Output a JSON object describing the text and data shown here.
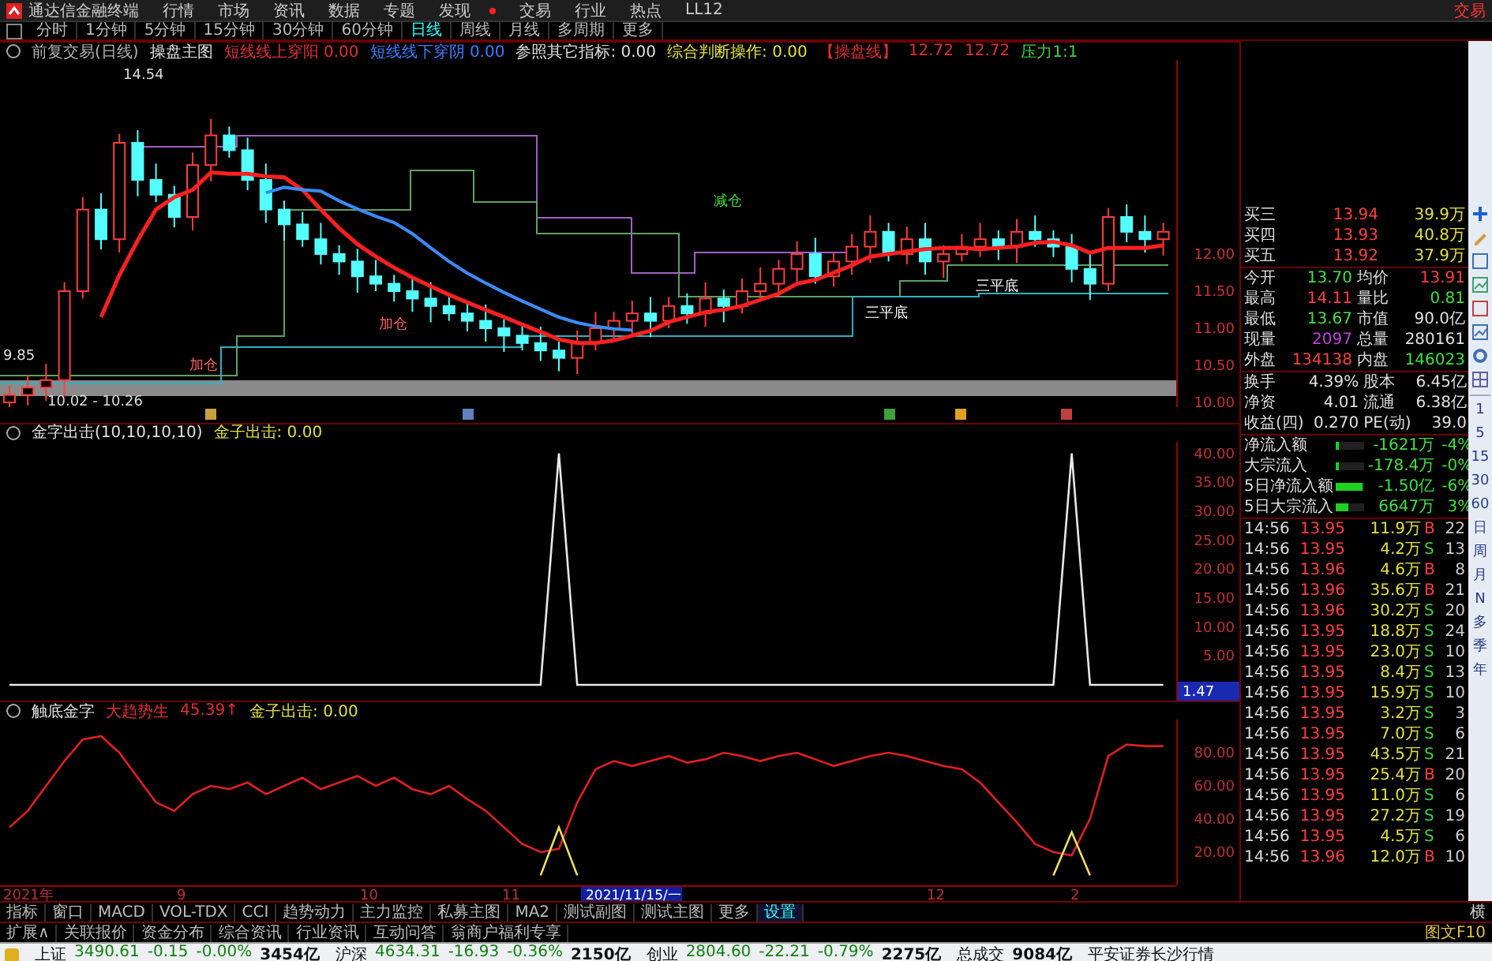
{
  "app": {
    "title": "通达信金融终端",
    "trade": "交易",
    "menu": [
      {
        "label": "行情",
        "dot": false
      },
      {
        "label": "市场",
        "dot": false
      },
      {
        "label": "资讯",
        "dot": false
      },
      {
        "label": "数据",
        "dot": false
      },
      {
        "label": "专题",
        "dot": false
      },
      {
        "label": "发现",
        "dot": true
      },
      {
        "label": "交易",
        "dot": false
      },
      {
        "label": "行业",
        "dot": false
      },
      {
        "label": "热点",
        "dot": false
      },
      {
        "label": "LL12",
        "dot": false
      }
    ]
  },
  "periods": [
    {
      "label": "分时",
      "selected": false
    },
    {
      "label": "1分钟",
      "selected": false
    },
    {
      "label": "5分钟",
      "selected": false
    },
    {
      "label": "15分钟",
      "selected": false
    },
    {
      "label": "30分钟",
      "selected": false
    },
    {
      "label": "60分钟",
      "selected": false
    },
    {
      "label": "日线",
      "selected": true
    },
    {
      "label": "周线",
      "selected": false
    },
    {
      "label": "月线",
      "selected": false
    },
    {
      "label": "多周期",
      "selected": false
    },
    {
      "label": "更多",
      "selected": false
    }
  ],
  "main_chart": {
    "header": [
      {
        "text": "前复交易(日线)",
        "color": "#b0b0b0"
      },
      {
        "text": "操盘主图",
        "color": "#e0e0e0"
      },
      {
        "text": "短线线上穿阳 0.00",
        "color": "#e03030"
      },
      {
        "text": "短线线下穿阴 0.00",
        "color": "#3a7cff"
      },
      {
        "text": "参照其它指标: 0.00",
        "color": "#e0e0e0"
      },
      {
        "text": "综合判断操作: 0.00",
        "color": "#e0e040"
      },
      {
        "text": "【操盘线】",
        "color": "#e03030"
      },
      {
        "text": "12.72",
        "color": "#e03030"
      },
      {
        "text": "12.72",
        "color": "#e03030"
      },
      {
        "text": "压力1:1",
        "color": "#40d040"
      }
    ],
    "annotations": [
      {
        "text": "14.54"
      },
      {
        "text": "9.85"
      },
      {
        "text": "10.02 - 10.26"
      },
      {
        "text": "加仓"
      },
      {
        "text": "加仓"
      },
      {
        "text": "减仓"
      },
      {
        "text": "三平底"
      },
      {
        "text": "三平底"
      }
    ],
    "price_axis": [
      "12.00",
      "11.50",
      "11.00",
      "10.50",
      "10.00"
    ]
  },
  "indicator_1": {
    "header": [
      {
        "text": "金字出击(10,10,10,10)",
        "color": "#e0e0e0"
      },
      {
        "text": "金子出击: 0.00",
        "color": "#e0e040"
      }
    ],
    "cursor_value": "1.47",
    "chart_data": {
      "type": "line",
      "ylim": [
        -3,
        42
      ],
      "yticks": [
        {
          "value": 40,
          "label": "40.00"
        },
        {
          "value": 35,
          "label": "35.00"
        },
        {
          "value": 30,
          "label": "30.00"
        },
        {
          "value": 25,
          "label": "25.00"
        },
        {
          "value": 20,
          "label": "20.00"
        },
        {
          "value": 15,
          "label": "15.00"
        },
        {
          "value": 10,
          "label": "10.00"
        },
        {
          "value": 5,
          "label": "5.00"
        }
      ],
      "series": [
        {
          "color": "#e8e8e8",
          "values": [
            0,
            0,
            0,
            0,
            0,
            0,
            0,
            0,
            0,
            0,
            0,
            0,
            0,
            0,
            0,
            0,
            0,
            0,
            0,
            0,
            0,
            0,
            0,
            0,
            0,
            0,
            0,
            0,
            0,
            0,
            40,
            0,
            0,
            0,
            0,
            0,
            0,
            0,
            0,
            0,
            0,
            0,
            0,
            0,
            0,
            0,
            0,
            0,
            0,
            0,
            0,
            0,
            0,
            0,
            0,
            0,
            0,
            0,
            40,
            0,
            0,
            0,
            0,
            0
          ]
        }
      ]
    }
  },
  "indicator_2": {
    "header": [
      {
        "text": "触底金字",
        "color": "#e0e0e0"
      },
      {
        "text": "大趋势生",
        "color": "#e03030"
      },
      {
        "text": "45.39↑",
        "color": "#e03030"
      },
      {
        "text": "金子出击: 0.00",
        "color": "#e0e040"
      }
    ],
    "chart_data": {
      "type": "line",
      "ylim": [
        0,
        100
      ],
      "yticks": [
        {
          "value": 80,
          "label": "80.00"
        },
        {
          "value": 60,
          "label": "60.00"
        },
        {
          "value": 40,
          "label": "40.00"
        },
        {
          "value": 20,
          "label": "20.00"
        }
      ],
      "series": [
        {
          "color": "#e02020",
          "values": [
            35,
            45,
            60,
            75,
            88,
            90,
            80,
            65,
            50,
            45,
            55,
            60,
            58,
            62,
            55,
            60,
            65,
            58,
            62,
            66,
            60,
            65,
            58,
            55,
            60,
            52,
            45,
            35,
            25,
            20,
            22,
            50,
            70,
            75,
            72,
            75,
            78,
            74,
            76,
            80,
            78,
            75,
            78,
            80,
            76,
            72,
            75,
            78,
            80,
            78,
            75,
            72,
            70,
            62,
            50,
            38,
            25,
            20,
            18,
            40,
            78,
            85,
            84,
            84
          ]
        },
        {
          "color": "#f0e060",
          "values": [
            null,
            null,
            null,
            null,
            null,
            null,
            null,
            null,
            null,
            null,
            null,
            null,
            null,
            null,
            null,
            null,
            null,
            null,
            null,
            null,
            null,
            null,
            null,
            null,
            null,
            null,
            null,
            null,
            null,
            6,
            35,
            6,
            null,
            null,
            null,
            null,
            null,
            null,
            null,
            null,
            null,
            null,
            null,
            null,
            null,
            null,
            null,
            null,
            null,
            null,
            null,
            null,
            null,
            null,
            null,
            null,
            null,
            6,
            32,
            6,
            null,
            null,
            null,
            null
          ]
        }
      ]
    }
  },
  "date_axis": {
    "labels": [
      "2021年",
      "9",
      "10",
      "11",
      "12",
      "2"
    ],
    "cursor_date": "2021/11/15/一"
  },
  "quote_panel": {
    "bids": [
      {
        "label": "买三",
        "price": "13.94",
        "volume": "39.9万"
      },
      {
        "label": "买四",
        "price": "13.93",
        "volume": "40.8万"
      },
      {
        "label": "买五",
        "price": "13.92",
        "volume": "37.9万"
      }
    ],
    "stats": [
      {
        "label": "今开",
        "value": "13.70",
        "color": "#40e040"
      },
      {
        "label": "均价",
        "value": "13.91",
        "color": "#ff4040"
      },
      {
        "label": "最高",
        "value": "14.11",
        "color": "#ff4040"
      },
      {
        "label": "量比",
        "value": "0.81",
        "color": "#40e040"
      },
      {
        "label": "最低",
        "value": "13.67",
        "color": "#40e040"
      },
      {
        "label": "市值",
        "value": "90.0亿",
        "color": "#e0e0e0"
      },
      {
        "label": "现量",
        "value": "2097",
        "color": "#c040e0"
      },
      {
        "label": "总量",
        "value": "280161",
        "color": "#e0e0e0"
      },
      {
        "label": "外盘",
        "value": "134138",
        "color": "#ff4040"
      },
      {
        "label": "内盘",
        "value": "146023",
        "color": "#40e040"
      }
    ],
    "stats2": [
      {
        "label": "换手",
        "value": "4.39%",
        "label2": "股本",
        "value2": "6.45亿"
      },
      {
        "label": "净资",
        "value": "4.01",
        "label2": "流通",
        "value2": "6.38亿"
      },
      {
        "label": "收益(四)",
        "value": "0.270",
        "label2": "PE(动)",
        "value2": "39.0"
      }
    ],
    "fund_flow": [
      {
        "label": "净流入额",
        "level": 0.08,
        "value": "-1621万",
        "pct": "-4%"
      },
      {
        "label": "大宗流入",
        "level": 0.08,
        "value": "-178.4万",
        "pct": "-0%"
      },
      {
        "label": "5日净流入额",
        "level": 0.9,
        "value": "-1.50亿",
        "pct": "-6%"
      },
      {
        "label": "5日大宗流入",
        "level": 0.4,
        "value": "6647万",
        "pct": "3%"
      }
    ],
    "ticks": [
      {
        "time": "14:56",
        "price": "13.95",
        "volume": "11.9万",
        "flag": "B",
        "kind": "buy",
        "count": "22"
      },
      {
        "time": "14:56",
        "price": "13.95",
        "volume": "4.2万",
        "flag": "S",
        "kind": "sell",
        "count": "13"
      },
      {
        "time": "14:56",
        "price": "13.96",
        "volume": "4.6万",
        "flag": "B",
        "kind": "buy",
        "count": "8"
      },
      {
        "time": "14:56",
        "price": "13.96",
        "volume": "35.6万",
        "flag": "B",
        "kind": "buy",
        "count": "21"
      },
      {
        "time": "14:56",
        "price": "13.96",
        "volume": "30.2万",
        "flag": "S",
        "kind": "sell",
        "count": "20"
      },
      {
        "time": "14:56",
        "price": "13.95",
        "volume": "18.8万",
        "flag": "S",
        "kind": "sell",
        "count": "24"
      },
      {
        "time": "14:56",
        "price": "13.95",
        "volume": "23.0万",
        "flag": "S",
        "kind": "sell",
        "count": "10"
      },
      {
        "time": "14:56",
        "price": "13.95",
        "volume": "8.4万",
        "flag": "S",
        "kind": "sell",
        "count": "13"
      },
      {
        "time": "14:56",
        "price": "13.95",
        "volume": "15.9万",
        "flag": "S",
        "kind": "sell",
        "count": "10"
      },
      {
        "time": "14:56",
        "price": "13.95",
        "volume": "3.2万",
        "flag": "S",
        "kind": "sell",
        "count": "3"
      },
      {
        "time": "14:56",
        "price": "13.95",
        "volume": "7.0万",
        "flag": "S",
        "kind": "sell",
        "count": "6"
      },
      {
        "time": "14:56",
        "price": "13.95",
        "volume": "43.5万",
        "flag": "S",
        "kind": "sell",
        "count": "21"
      },
      {
        "time": "14:56",
        "price": "13.95",
        "volume": "25.4万",
        "flag": "B",
        "kind": "buy",
        "count": "20"
      },
      {
        "time": "14:56",
        "price": "13.95",
        "volume": "11.0万",
        "flag": "S",
        "kind": "sell",
        "count": "6"
      },
      {
        "time": "14:56",
        "price": "13.95",
        "volume": "27.2万",
        "flag": "S",
        "kind": "sell",
        "count": "19"
      },
      {
        "time": "14:56",
        "price": "13.95",
        "volume": "4.5万",
        "flag": "S",
        "kind": "sell",
        "count": "6"
      },
      {
        "time": "14:56",
        "price": "13.96",
        "volume": "12.0万",
        "flag": "B",
        "kind": "buy",
        "count": "10"
      }
    ]
  },
  "side_toolbar": {
    "periods": [
      "1",
      "5",
      "15",
      "30",
      "60",
      "日",
      "周",
      "月",
      "N",
      "多",
      "季",
      "年"
    ]
  },
  "tabs": [
    {
      "label": "指标",
      "selected": false
    },
    {
      "label": "窗口",
      "selected": false
    },
    {
      "label": "MACD",
      "selected": false
    },
    {
      "label": "VOL-TDX",
      "selected": false
    },
    {
      "label": "CCI",
      "selected": false
    },
    {
      "label": "趋势动力",
      "selected": false
    },
    {
      "label": "主力监控",
      "selected": false
    },
    {
      "label": "私募主图",
      "selected": false
    },
    {
      "label": "MA2",
      "selected": false
    },
    {
      "label": "测试副图",
      "selected": false
    },
    {
      "label": "测试主图",
      "selected": false
    },
    {
      "label": "更多",
      "selected": false
    },
    {
      "label": "设置",
      "selected": true
    }
  ],
  "tabs_right": "横",
  "extension_tabs": [
    "扩展∧",
    "关联报价",
    "资金分布",
    "综合资讯",
    "行业资讯",
    "互动问答",
    "翁商户福利专享"
  ],
  "extension_right": "图文F10",
  "status_bar": {
    "indices": [
      {
        "name": "上证",
        "value": "3490.61",
        "change": "-0.15",
        "pct": "-0.00%",
        "amount": "3454亿"
      },
      {
        "name": "沪深",
        "value": "4634.31",
        "change": "-16.93",
        "pct": "-0.36%",
        "amount": "2150亿"
      },
      {
        "name": "创业",
        "value": "2804.60",
        "change": "-22.21",
        "pct": "-0.79%",
        "amount": "2275亿"
      }
    ],
    "total_label": "总成交",
    "total_value": "9084亿",
    "broker": "平安证券长沙行情"
  }
}
